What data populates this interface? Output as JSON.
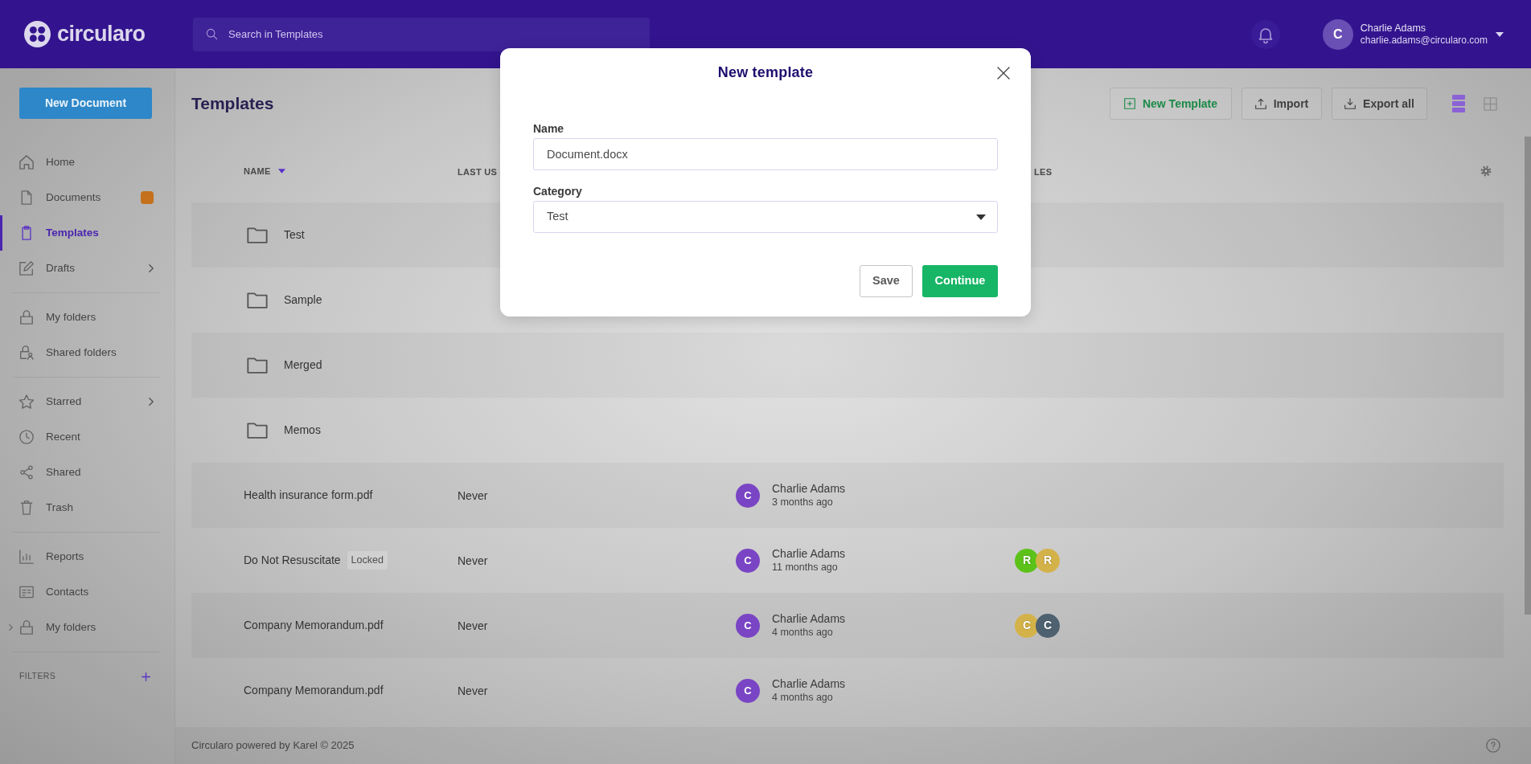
{
  "topbar": {
    "logo": "circularo",
    "search": {
      "placeholder": "Search in Templates"
    },
    "user": {
      "initial": "C",
      "name": "Charlie Adams",
      "email": "charlie.adams@circularo.com"
    }
  },
  "sidebar": {
    "new_button": "New Document",
    "sections": [
      {
        "items": [
          {
            "label": "Home",
            "kind": "link",
            "selected": false,
            "has_badge": false
          },
          {
            "label": "Documents",
            "kind": "link",
            "selected": false,
            "has_badge": true
          },
          {
            "label": "Templates",
            "kind": "link",
            "selected": true,
            "has_badge": false
          },
          {
            "label": "Drafts",
            "kind": "submenu",
            "selected": false,
            "has_badge": false
          }
        ]
      },
      {
        "items": [
          {
            "label": "My folders",
            "kind": "link",
            "selected": false,
            "has_badge": false
          },
          {
            "label": "Shared folders",
            "kind": "link",
            "selected": false,
            "has_badge": false
          }
        ]
      },
      {
        "items": [
          {
            "label": "Starred",
            "kind": "submenu",
            "selected": false,
            "has_badge": false
          },
          {
            "label": "Recent",
            "kind": "link",
            "selected": false,
            "has_badge": false
          },
          {
            "label": "Shared",
            "kind": "link",
            "selected": false,
            "has_badge": false
          },
          {
            "label": "Trash",
            "kind": "link",
            "selected": false,
            "has_badge": false
          }
        ]
      },
      {
        "items": [
          {
            "label": "Reports",
            "kind": "link",
            "selected": false,
            "has_badge": false
          },
          {
            "label": "Contacts",
            "kind": "link",
            "selected": false,
            "has_badge": false
          },
          {
            "label": "My folders",
            "kind": "tree",
            "selected": false,
            "has_badge": false
          }
        ]
      }
    ],
    "filters": {
      "label": "FILTERS"
    }
  },
  "page": {
    "title": "Templates",
    "toolbar": {
      "buttons": [
        {
          "label": "New Template",
          "kind": "primary"
        },
        {
          "label": "Import",
          "kind": "default"
        },
        {
          "label": "Export all",
          "kind": "default"
        }
      ],
      "views": [
        {
          "selected": true
        },
        {
          "selected": false
        }
      ]
    }
  },
  "table": {
    "columns": {
      "column_1": {
        "label": "NAME",
        "sorted": true
      },
      "column_2": {
        "label": "LAST US"
      },
      "column_4": {
        "label": "LES"
      }
    },
    "rows": [
      {
        "kind": "folder",
        "name": "Test"
      },
      {
        "kind": "folder",
        "name": "Sample"
      },
      {
        "kind": "folder",
        "name": "Merged"
      },
      {
        "kind": "folder",
        "name": "Memos"
      },
      {
        "kind": "file",
        "name": "Health insurance form.pdf",
        "last_used": "Never",
        "creator": {
          "initial": "C",
          "name": "Charlie Adams",
          "time": "3 months ago"
        }
      },
      {
        "kind": "file",
        "name": "Do Not Resuscitate",
        "tag": "Locked",
        "last_used": "Never",
        "creator": {
          "initial": "C",
          "name": "Charlie Adams",
          "time": "11 months ago"
        },
        "roles": [
          {
            "initial": "R",
            "color": "#5cc21a"
          },
          {
            "initial": "R",
            "color": "#d4b24a"
          }
        ]
      },
      {
        "kind": "file",
        "name": "Company Memorandum.pdf",
        "last_used": "Never",
        "creator": {
          "initial": "C",
          "name": "Charlie Adams",
          "time": "4 months ago"
        },
        "roles": [
          {
            "initial": "C",
            "color": "#d4b24a"
          },
          {
            "initial": "C",
            "color": "#4d6170"
          }
        ]
      },
      {
        "kind": "file",
        "name": "Company Memorandum.pdf",
        "last_used": "Never",
        "creator": {
          "initial": "C",
          "name": "Charlie Adams",
          "time": "4 months ago"
        }
      }
    ]
  },
  "footer": {
    "text": "Circularo powered by Karel © 2025"
  },
  "dialog": {
    "title": "New template",
    "fields": [
      {
        "kind": "text",
        "label": "Name",
        "value": "Document.docx"
      },
      {
        "kind": "select",
        "label": "Category",
        "value": "Test"
      }
    ],
    "buttons": [
      {
        "label": "Save",
        "kind": "secondary"
      },
      {
        "label": "Continue",
        "kind": "primary"
      }
    ]
  }
}
